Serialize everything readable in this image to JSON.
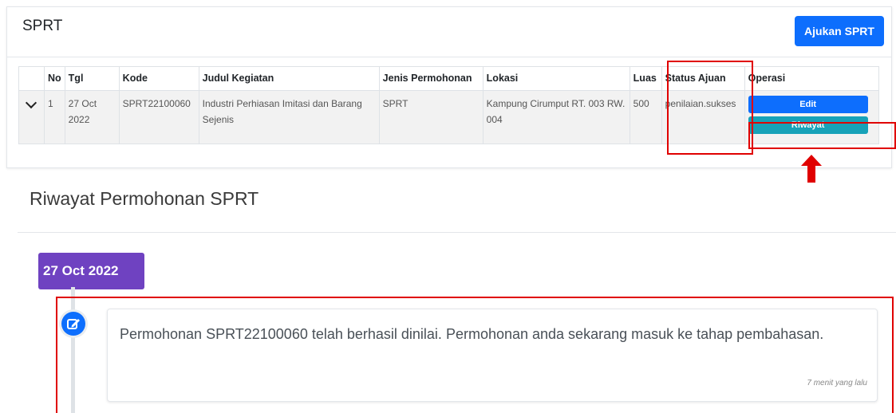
{
  "card": {
    "title": "SPRT",
    "submit_label": "Ajukan SPRT"
  },
  "table": {
    "headers": {
      "no": "No",
      "tgl": "Tgl",
      "kode": "Kode",
      "judul": "Judul Kegiatan",
      "jenis": "Jenis Permohonan",
      "lokasi": "Lokasi",
      "luas": "Luas",
      "status": "Status Ajuan",
      "operasi": "Operasi"
    },
    "rows": [
      {
        "no": "1",
        "tgl": "27 Oct 2022",
        "kode": "SPRT22100060",
        "judul": "Industri Perhiasan Imitasi dan Barang Sejenis",
        "jenis": "SPRT",
        "lokasi": "Kampung Cirumput RT. 003 RW. 004",
        "luas": "500",
        "status": "penilaian.sukses",
        "edit_label": "Edit",
        "riwayat_label": "Riwayat"
      }
    ]
  },
  "history": {
    "title": "Riwayat Permohonan SPRT",
    "date_badge": "27 Oct 2022",
    "items": [
      {
        "icon": "edit-icon",
        "message": "Permohonan SPRT22100060 telah berhasil dinilai. Permohonan anda sekarang masuk ke tahap pembahasan.",
        "time": "7 menit yang lalu"
      }
    ]
  },
  "colors": {
    "primary": "#0d6efd",
    "info": "#17a2b8",
    "badge": "#6f42c1",
    "highlight": "#e00000"
  }
}
